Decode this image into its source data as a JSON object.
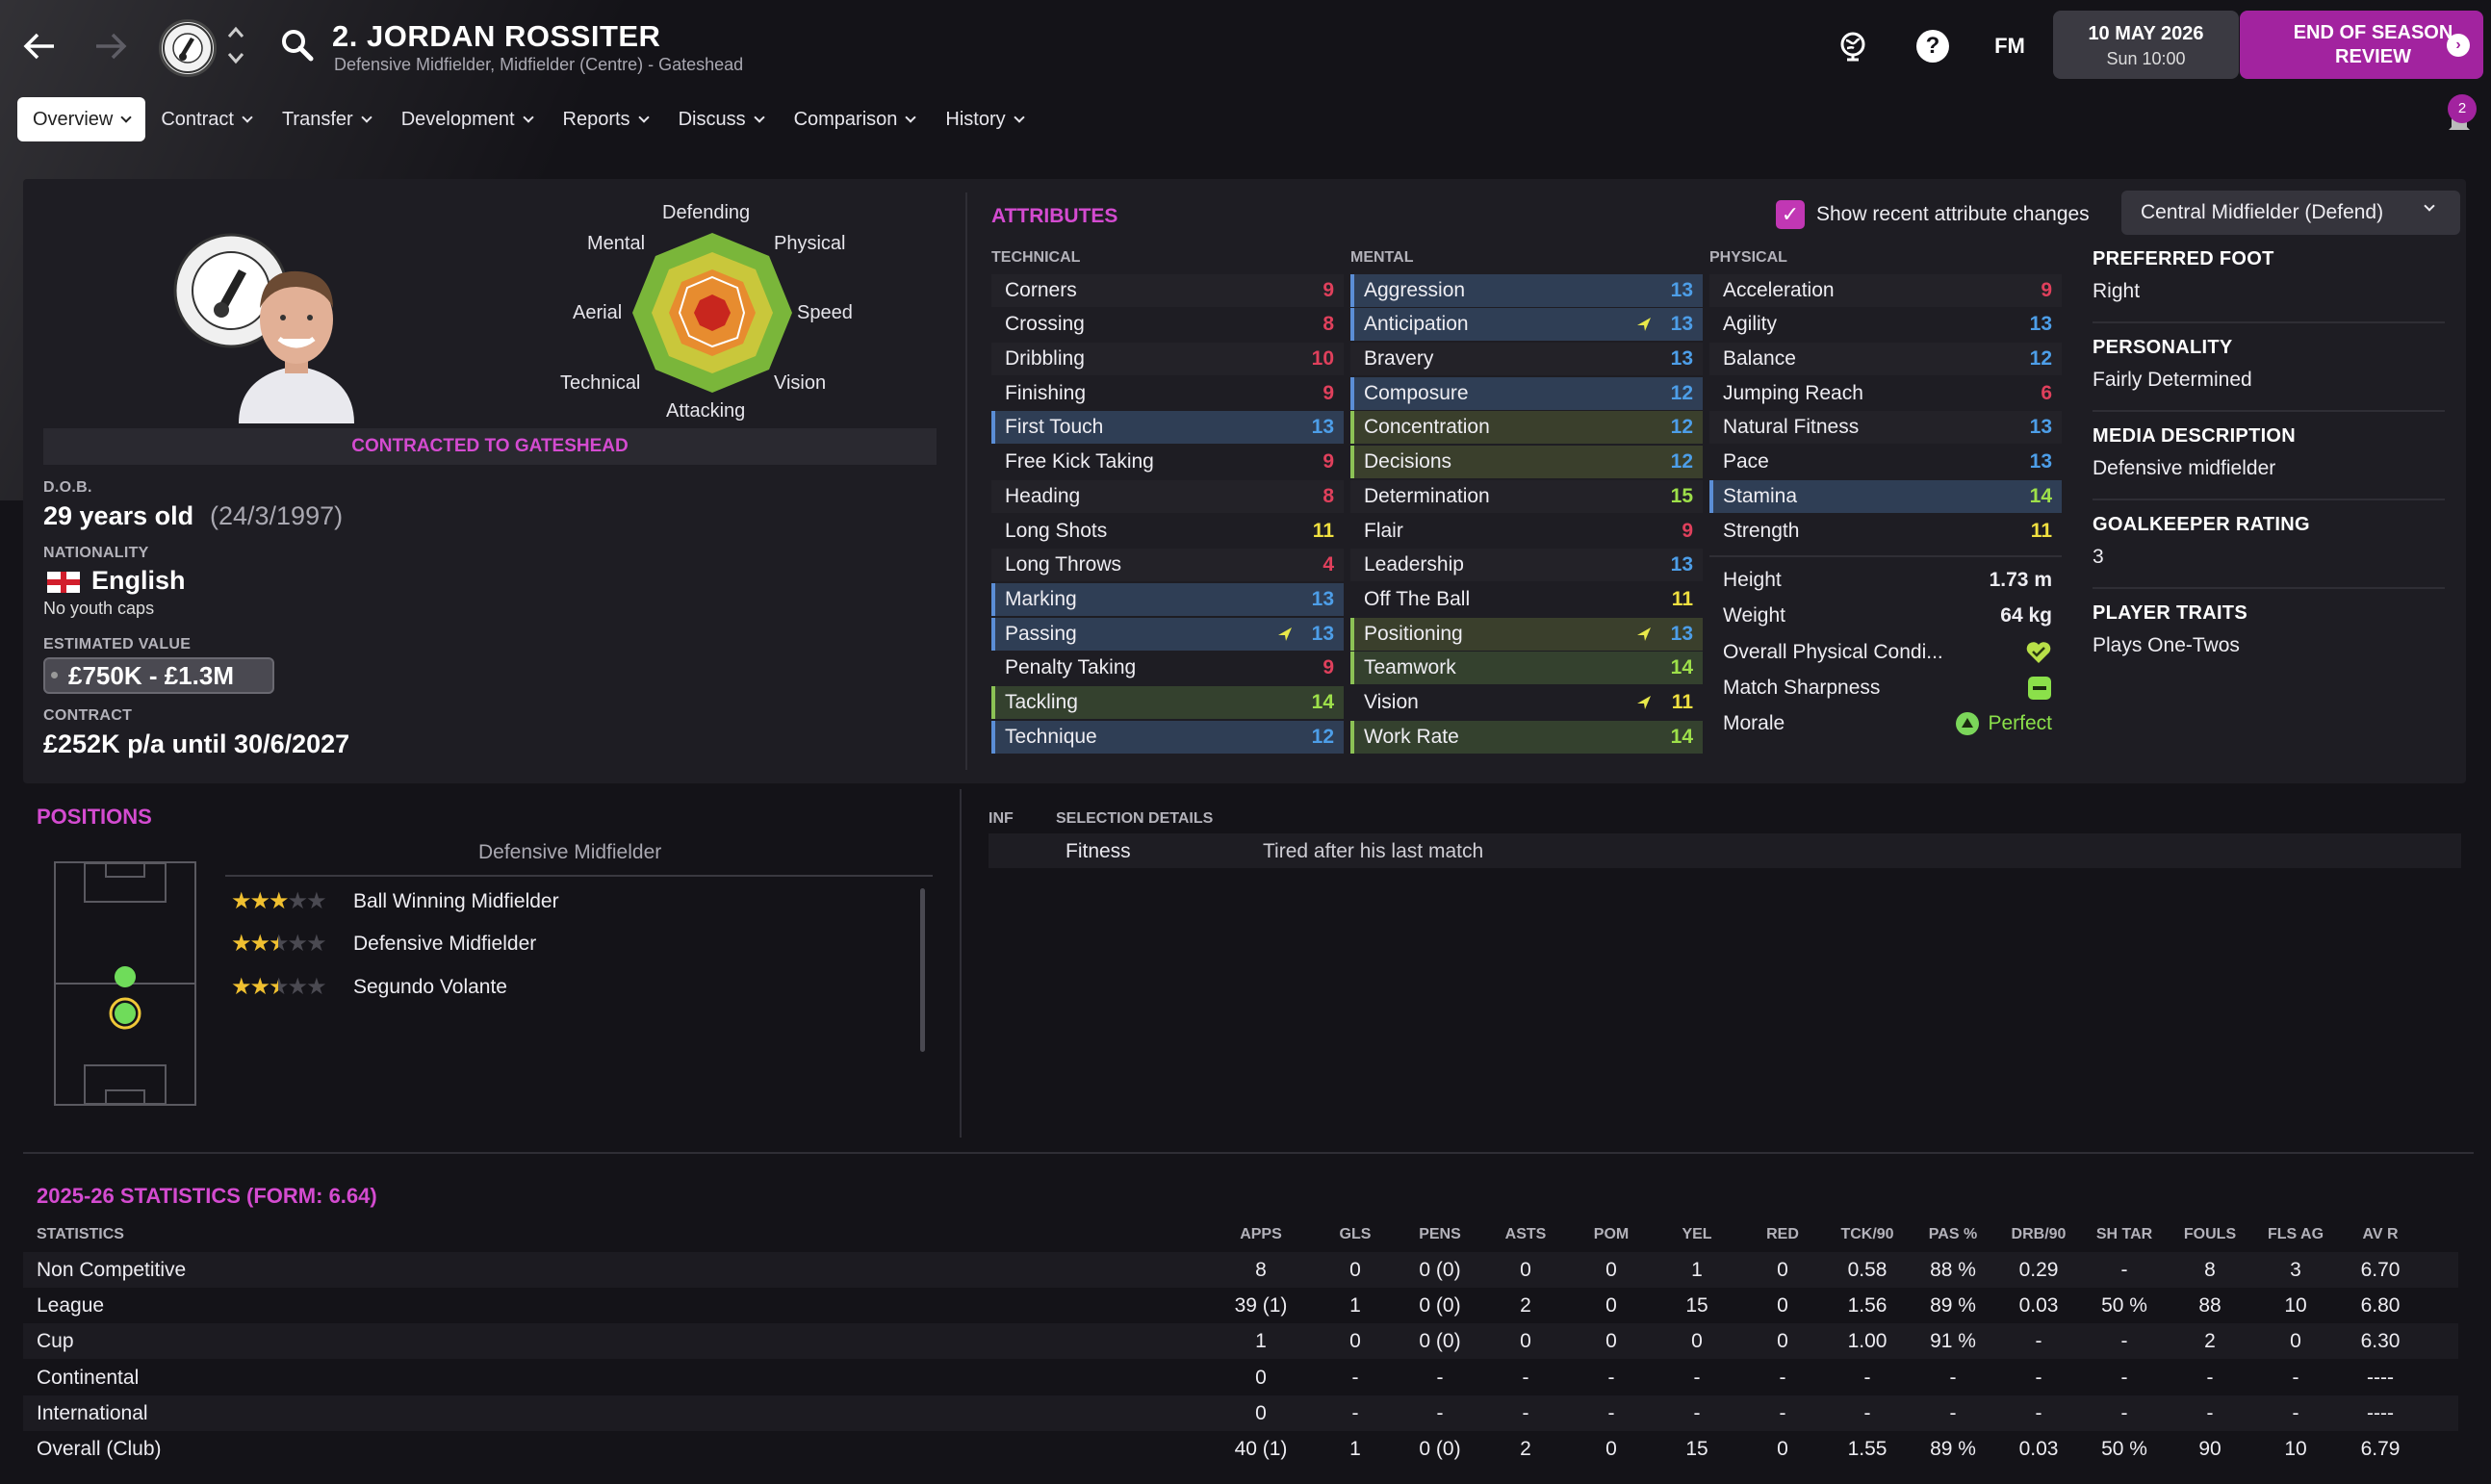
{
  "header": {
    "player_name": "2. JORDAN ROSSITER",
    "player_subtitle": "Defensive Midfielder, Midfielder (Centre) - Gateshead",
    "date_line1": "10 MAY 2026",
    "date_line2": "Sun 10:00",
    "eos_line1": "END OF SEASON",
    "eos_line2": "REVIEW",
    "fm_label": "FM",
    "help_label": "?"
  },
  "tabs": [
    {
      "label": "Overview"
    },
    {
      "label": "Contract"
    },
    {
      "label": "Transfer"
    },
    {
      "label": "Development"
    },
    {
      "label": "Reports"
    },
    {
      "label": "Discuss"
    },
    {
      "label": "Comparison"
    },
    {
      "label": "History"
    }
  ],
  "notification_count": "2",
  "profile": {
    "club_badge_text": "GATESHEAD",
    "contracted": "CONTRACTED TO GATESHEAD",
    "dob_label": "D.O.B.",
    "age": "29 years old",
    "dob": "(24/3/1997)",
    "nationality_label": "NATIONALITY",
    "nationality": "English",
    "youth_caps": "No youth caps",
    "value_label": "ESTIMATED VALUE",
    "value": "£750K - £1.3M",
    "contract_label": "CONTRACT",
    "contract": "£252K p/a until 30/6/2027"
  },
  "radar": {
    "labels": [
      "Defending",
      "Physical",
      "Speed",
      "Vision",
      "Attacking",
      "Technical",
      "Aerial",
      "Mental"
    ]
  },
  "attributes": {
    "title": "ATTRIBUTES",
    "show_changes": "Show recent attribute changes",
    "role": "Central Midfielder (Defend)",
    "technical_label": "TECHNICAL",
    "mental_label": "MENTAL",
    "physical_label": "PHYSICAL",
    "technical": [
      {
        "name": "Corners",
        "value": "9"
      },
      {
        "name": "Crossing",
        "value": "8"
      },
      {
        "name": "Dribbling",
        "value": "10"
      },
      {
        "name": "Finishing",
        "value": "9"
      },
      {
        "name": "First Touch",
        "value": "13"
      },
      {
        "name": "Free Kick Taking",
        "value": "9"
      },
      {
        "name": "Heading",
        "value": "8"
      },
      {
        "name": "Long Shots",
        "value": "11"
      },
      {
        "name": "Long Throws",
        "value": "4"
      },
      {
        "name": "Marking",
        "value": "13"
      },
      {
        "name": "Passing",
        "value": "13"
      },
      {
        "name": "Penalty Taking",
        "value": "9"
      },
      {
        "name": "Tackling",
        "value": "14"
      },
      {
        "name": "Technique",
        "value": "12"
      }
    ],
    "mental": [
      {
        "name": "Aggression",
        "value": "13"
      },
      {
        "name": "Anticipation",
        "value": "13"
      },
      {
        "name": "Bravery",
        "value": "13"
      },
      {
        "name": "Composure",
        "value": "12"
      },
      {
        "name": "Concentration",
        "value": "12"
      },
      {
        "name": "Decisions",
        "value": "12"
      },
      {
        "name": "Determination",
        "value": "15"
      },
      {
        "name": "Flair",
        "value": "9"
      },
      {
        "name": "Leadership",
        "value": "13"
      },
      {
        "name": "Off The Ball",
        "value": "11"
      },
      {
        "name": "Positioning",
        "value": "13"
      },
      {
        "name": "Teamwork",
        "value": "14"
      },
      {
        "name": "Vision",
        "value": "11"
      },
      {
        "name": "Work Rate",
        "value": "14"
      }
    ],
    "physical": [
      {
        "name": "Acceleration",
        "value": "9"
      },
      {
        "name": "Agility",
        "value": "13"
      },
      {
        "name": "Balance",
        "value": "12"
      },
      {
        "name": "Jumping Reach",
        "value": "6"
      },
      {
        "name": "Natural Fitness",
        "value": "13"
      },
      {
        "name": "Pace",
        "value": "13"
      },
      {
        "name": "Stamina",
        "value": "14"
      },
      {
        "name": "Strength",
        "value": "11"
      }
    ],
    "height_label": "Height",
    "height": "1.73 m",
    "weight_label": "Weight",
    "weight": "64 kg",
    "condition_label": "Overall Physical Condi...",
    "sharpness_label": "Match Sharpness",
    "morale_label": "Morale",
    "morale": "Perfect"
  },
  "side": {
    "foot_label": "PREFERRED FOOT",
    "foot": "Right",
    "personality_label": "PERSONALITY",
    "personality": "Fairly Determined",
    "media_label": "MEDIA DESCRIPTION",
    "media": "Defensive midfielder",
    "gk_label": "GOALKEEPER RATING",
    "gk": "3",
    "traits_label": "PLAYER TRAITS",
    "traits": "Plays One-Twos"
  },
  "positions": {
    "title": "POSITIONS",
    "main": "Defensive Midfielder",
    "roles": [
      {
        "name": "Ball Winning Midfielder",
        "stars": 3
      },
      {
        "name": "Defensive Midfielder",
        "stars": 2.5
      },
      {
        "name": "Segundo Volante",
        "stars": 2.5
      }
    ]
  },
  "selection": {
    "inf_label": "INF",
    "details_label": "SELECTION DETAILS",
    "item": "Fitness",
    "detail": "Tired after his last match"
  },
  "stats": {
    "title": "2025-26 STATISTICS (FORM: 6.64)",
    "row_label": "STATISTICS",
    "columns": [
      "APPS",
      "GLS",
      "PENS",
      "ASTS",
      "POM",
      "YEL",
      "RED",
      "TCK/90",
      "PAS %",
      "DRB/90",
      "SH TAR",
      "FOULS",
      "FLS AG",
      "AV R"
    ],
    "rows": [
      {
        "label": "Non Competitive",
        "values": [
          "8",
          "0",
          "0 (0)",
          "0",
          "0",
          "1",
          "0",
          "0.58",
          "88 %",
          "0.29",
          "-",
          "8",
          "3",
          "6.70"
        ]
      },
      {
        "label": "League",
        "values": [
          "39 (1)",
          "1",
          "0 (0)",
          "2",
          "0",
          "15",
          "0",
          "1.56",
          "89 %",
          "0.03",
          "50 %",
          "88",
          "10",
          "6.80"
        ]
      },
      {
        "label": "Cup",
        "values": [
          "1",
          "0",
          "0 (0)",
          "0",
          "0",
          "0",
          "0",
          "1.00",
          "91 %",
          "-",
          "-",
          "2",
          "0",
          "6.30"
        ]
      },
      {
        "label": "Continental",
        "values": [
          "0",
          "-",
          "-",
          "-",
          "-",
          "-",
          "-",
          "-",
          "-",
          "-",
          "-",
          "-",
          "-",
          "----"
        ]
      },
      {
        "label": "International",
        "values": [
          "0",
          "-",
          "-",
          "-",
          "-",
          "-",
          "-",
          "-",
          "-",
          "-",
          "-",
          "-",
          "-",
          "----"
        ]
      },
      {
        "label": "Overall (Club)",
        "values": [
          "40 (1)",
          "1",
          "0 (0)",
          "2",
          "0",
          "15",
          "0",
          "1.55",
          "89 %",
          "0.03",
          "50 %",
          "90",
          "10",
          "6.79"
        ]
      }
    ]
  }
}
